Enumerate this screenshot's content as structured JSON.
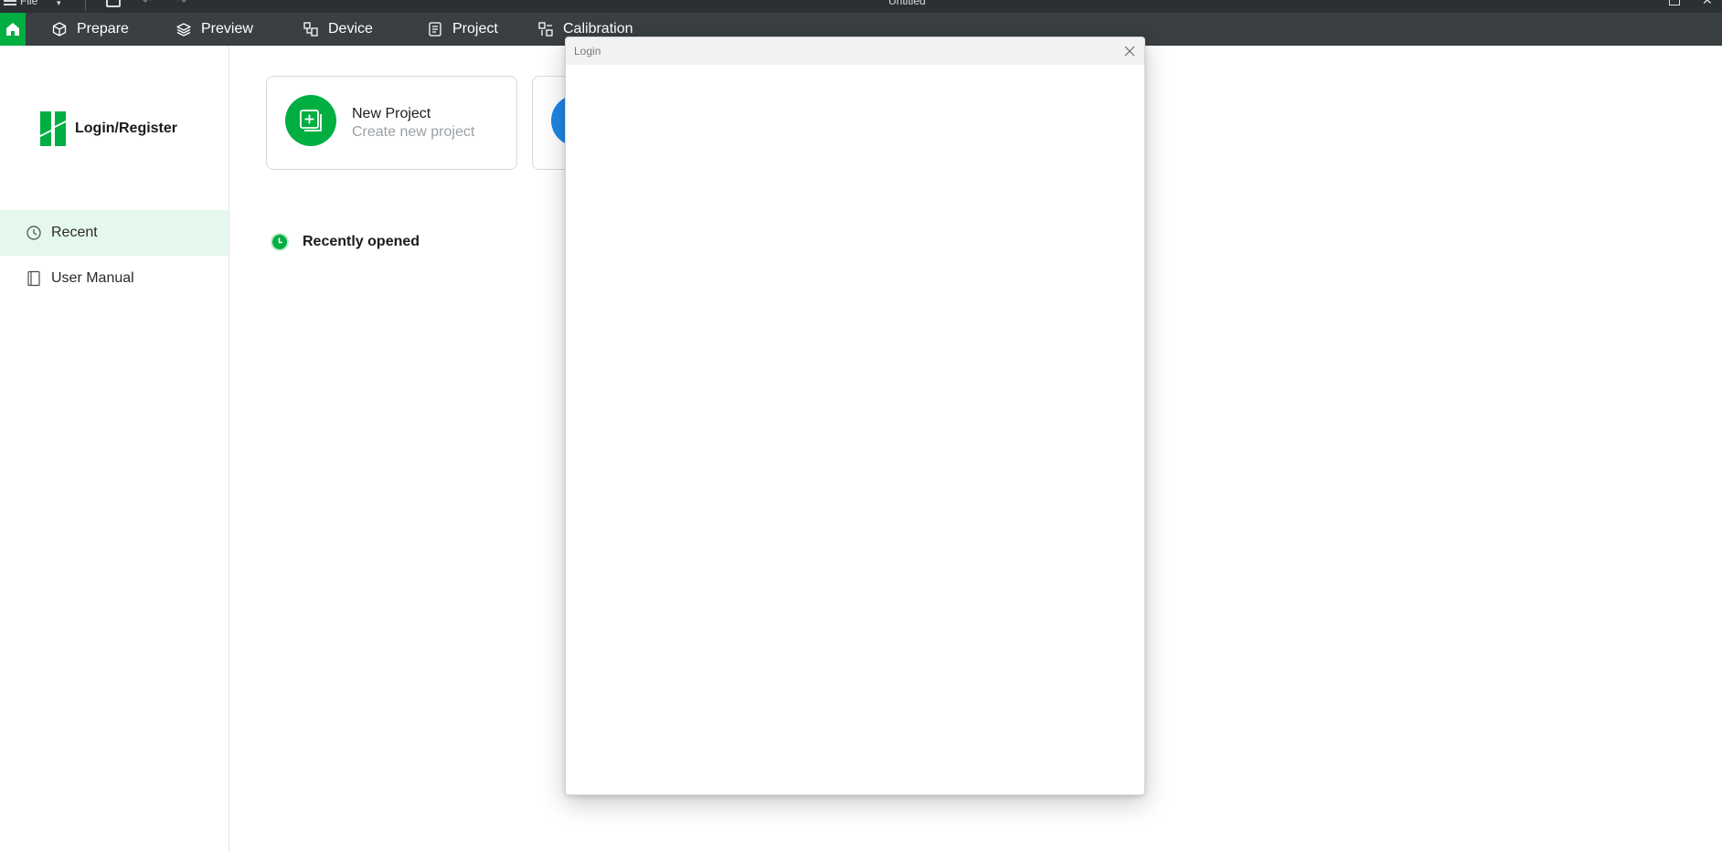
{
  "titlebar": {
    "menu_label": "File",
    "document_title": "Untitled"
  },
  "nav": {
    "items": [
      {
        "label": "Prepare",
        "icon": "cube-icon"
      },
      {
        "label": "Preview",
        "icon": "layers-icon"
      },
      {
        "label": "Device",
        "icon": "device-icon"
      },
      {
        "label": "Project",
        "icon": "project-icon"
      },
      {
        "label": "Calibration",
        "icon": "calibration-icon"
      }
    ]
  },
  "sidebar": {
    "login_label": "Login/Register",
    "items": [
      {
        "label": "Recent",
        "icon": "clock-icon",
        "active": true
      },
      {
        "label": "User Manual",
        "icon": "book-icon",
        "active": false
      }
    ]
  },
  "main": {
    "cards": [
      {
        "title": "New Project",
        "subtitle": "Create new project",
        "color": "#00ae42"
      },
      {
        "title": "",
        "subtitle": "",
        "color": "#1e88e5"
      }
    ],
    "recent_heading": "Recently opened"
  },
  "dialog": {
    "title": "Login"
  },
  "colors": {
    "brand_green": "#00ae42",
    "nav_bg": "#3a3f42",
    "active_bg": "#e5f8ec"
  }
}
